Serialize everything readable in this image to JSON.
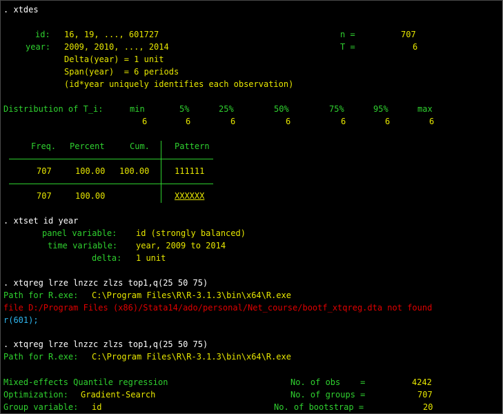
{
  "cmd_xtdes": ". xtdes",
  "xtdes": {
    "id_label": "id:",
    "id_value": "16, 19, ..., 601727",
    "n_label": "n =",
    "n_value": "707",
    "year_label": "year:",
    "year_value": "2009, 2010, ..., 2014",
    "T_label": "T =",
    "T_value": "6",
    "delta_line": "Delta(year) = 1 unit",
    "span_line": "Span(year)  = 6 periods",
    "unique_line": "(id*year uniquely identifies each observation)"
  },
  "dist": {
    "label": "Distribution of T_i:",
    "headers": [
      "min",
      "5%",
      "25%",
      "50%",
      "75%",
      "95%",
      "max"
    ],
    "values": [
      "6",
      "6",
      "6",
      "6",
      "6",
      "6",
      "6"
    ]
  },
  "pattern_table": {
    "headers": [
      "Freq.",
      "Percent",
      "Cum.",
      "Pattern"
    ],
    "row": [
      "707",
      "100.00",
      "100.00",
      "111111"
    ],
    "total": [
      "707",
      "100.00",
      "",
      "XXXXXX"
    ]
  },
  "cmd_xtset": ". xtset id year",
  "xtset": {
    "panel_label": "panel variable:",
    "panel_value": "id (strongly balanced)",
    "time_label": "time variable:",
    "time_value": "year, 2009 to 2014",
    "delta_label": "delta:",
    "delta_value": "1 unit"
  },
  "cmd_xtqreg1": ". xtqreg lrze lnzzc zlzs top1,q(25 50 75)",
  "path_label": "Path for R.exe:",
  "path_value": "C:\\Program Files\\R\\R-3.1.3\\bin\\x64\\R.exe",
  "error_msg": "file D:/Program Files (x86)/Stata14/ado/personal/Net_course/bootf_xtqreg.dta not found",
  "error_code": "r(601);",
  "cmd_xtqreg2": ". xtqreg lrze lnzzc zlzs top1,q(25 50 75)",
  "model": {
    "title": "Mixed-effects Quantile regression",
    "obs_label": "No. of obs    =",
    "obs_value": "4242",
    "opt_label": "Optimization:",
    "opt_value": "Gradient-Search",
    "groups_label": "No. of groups =",
    "groups_value": "707",
    "group_var_label": "Group variable:",
    "group_var_value": "id",
    "boot_label": "No. of bootstrap =",
    "boot_value": "20"
  },
  "colors": {
    "background": "#000000",
    "command": "#ffffff",
    "label": "#2fd12f",
    "result": "#e6e600",
    "error": "#e00000",
    "link": "#2fb7f0"
  }
}
